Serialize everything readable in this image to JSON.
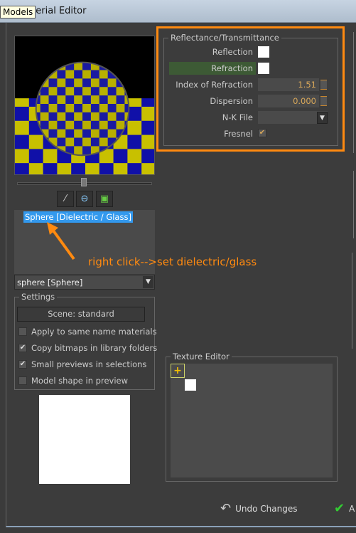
{
  "window": {
    "title": "Material Editor",
    "tooltip": "Models"
  },
  "tree": {
    "selected_item": "Sphere [Dielectric / Glass]"
  },
  "annotation": "right click-->set dielectric/glass",
  "model_dropdown": {
    "value": "sphere [Sphere]"
  },
  "settings": {
    "label": "Settings",
    "scene_button": "Scene: standard",
    "options": [
      {
        "label": "Apply to same name materials",
        "checked": false
      },
      {
        "label": "Copy bitmaps in library folders",
        "checked": true
      },
      {
        "label": "Small previews in selections",
        "checked": true
      },
      {
        "label": "Model shape in preview",
        "checked": false
      }
    ]
  },
  "reflectance": {
    "label": "Reflectance/Transmittance",
    "reflection": "Reflection",
    "refraction": "Refraction",
    "ior_label": "Index of Refraction",
    "ior_value": "1.51",
    "dispersion_label": "Dispersion",
    "dispersion_value": "0.000",
    "nk_label": "N-K File",
    "nk_value": "",
    "fresnel_label": "Fresnel",
    "fresnel_checked": true
  },
  "texture_editor": {
    "label": "Texture Editor"
  },
  "footer": {
    "undo": "Undo Changes",
    "apply": "A"
  },
  "colors": {
    "highlight": "#ff8a10",
    "selection": "#3399ee",
    "refraction_row": "#3d5a35"
  }
}
